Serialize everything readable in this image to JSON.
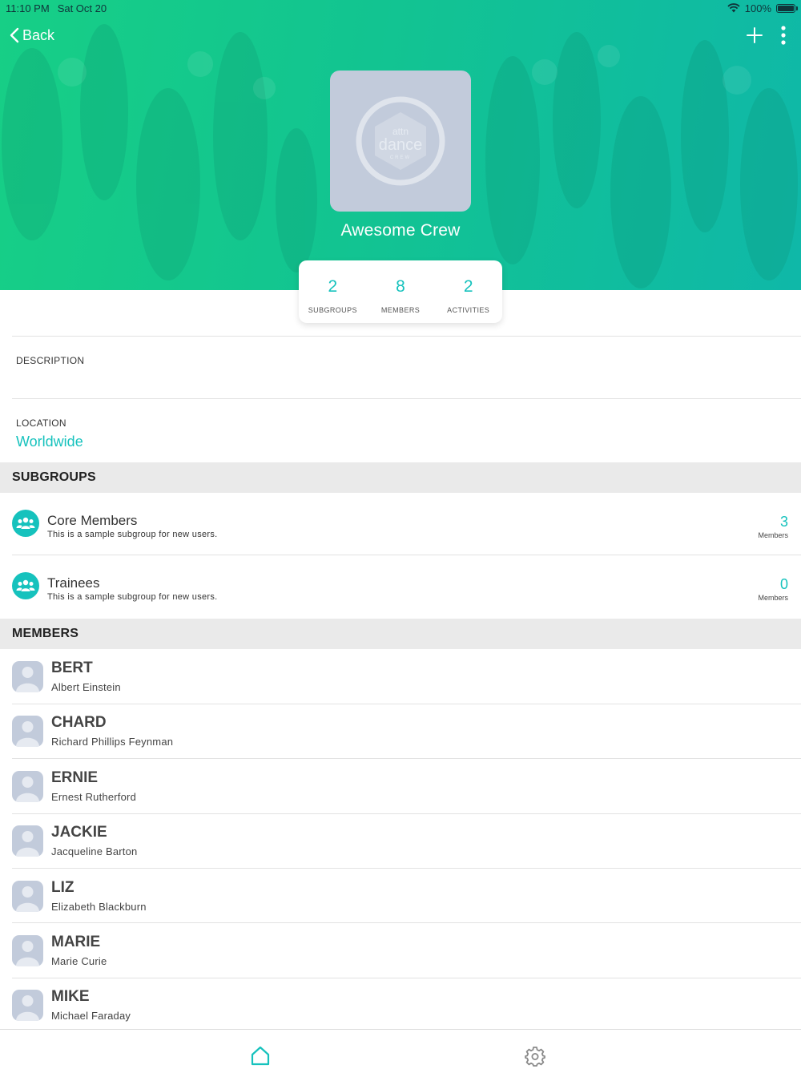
{
  "status_bar": {
    "time": "11:10 PM",
    "date": "Sat Oct 20",
    "battery": "100%"
  },
  "nav": {
    "back_label": "Back"
  },
  "group": {
    "name": "Awesome Crew",
    "logo_text_top": "attn",
    "logo_text_main": "dance",
    "logo_text_sub": "CREW"
  },
  "stats": [
    {
      "value": "2",
      "label": "SUBGROUPS"
    },
    {
      "value": "8",
      "label": "MEMBERS"
    },
    {
      "value": "2",
      "label": "ACTIVITIES"
    }
  ],
  "details": {
    "description_label": "DESCRIPTION",
    "description_value": "",
    "location_label": "LOCATION",
    "location_value": "Worldwide"
  },
  "subgroups_section": {
    "title": "SUBGROUPS",
    "items": [
      {
        "name": "Core Members",
        "description": "This is a sample subgroup for new users.",
        "count": "3",
        "count_label": "Members"
      },
      {
        "name": "Trainees",
        "description": "This is a sample subgroup for new users.",
        "count": "0",
        "count_label": "Members"
      }
    ]
  },
  "members_section": {
    "title": "MEMBERS",
    "items": [
      {
        "nickname": "BERT",
        "full_name": "Albert Einstein"
      },
      {
        "nickname": "CHARD",
        "full_name": "Richard Phillips Feynman"
      },
      {
        "nickname": "ERNIE",
        "full_name": "Ernest Rutherford"
      },
      {
        "nickname": "JACKIE",
        "full_name": "Jacqueline Barton"
      },
      {
        "nickname": "LIZ",
        "full_name": "Elizabeth Blackburn"
      },
      {
        "nickname": "MARIE",
        "full_name": "Marie Curie"
      },
      {
        "nickname": "MIKE",
        "full_name": "Michael Faraday"
      }
    ]
  },
  "colors": {
    "accent": "#16c2bd",
    "hero_start": "#17cf86",
    "hero_end": "#0fb8a8",
    "avatar_bg": "#c2cbdb",
    "section_bg": "#eaeaea"
  },
  "icons": {
    "back": "chevron-left-icon",
    "add": "plus-icon",
    "more": "more-vertical-icon",
    "subgroup": "group-people-icon",
    "avatar": "person-icon",
    "home": "home-icon",
    "settings": "gear-icon",
    "wifi": "wifi-icon",
    "battery": "battery-icon"
  }
}
